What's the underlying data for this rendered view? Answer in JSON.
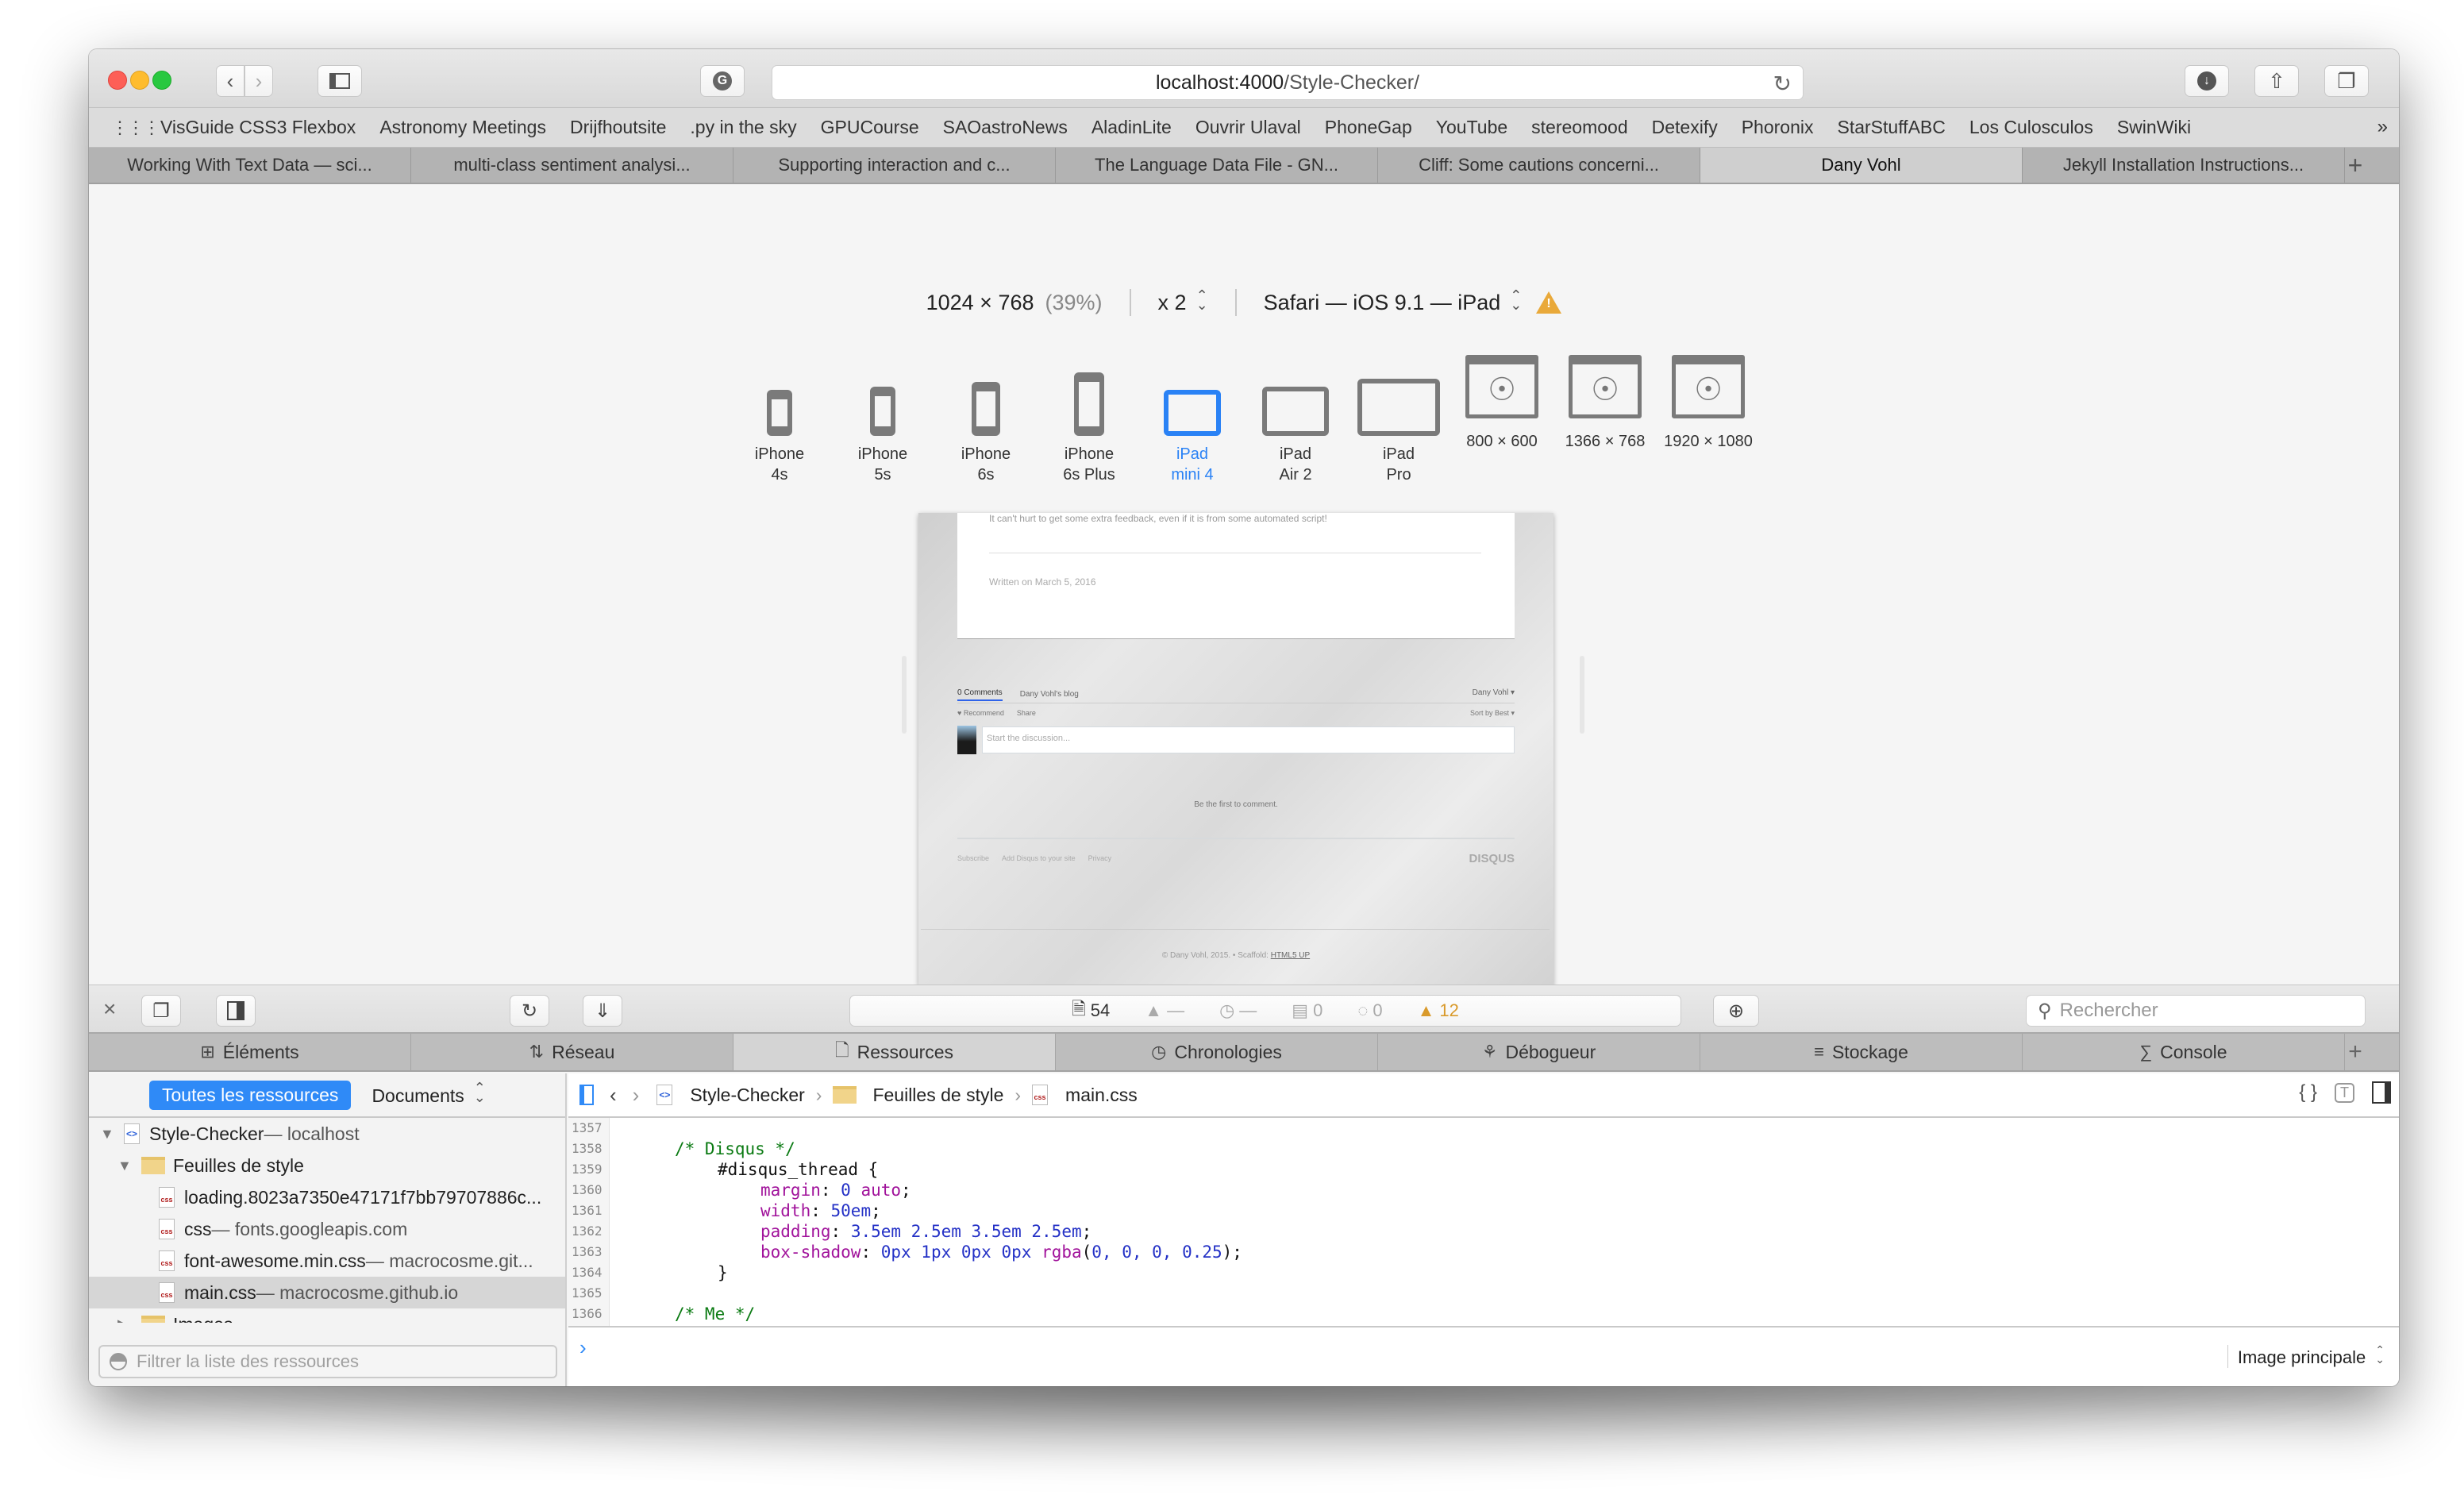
{
  "window": {
    "url_host": "localhost:4000",
    "url_path": "/Style-Checker/"
  },
  "bookmarks": [
    "VisGuide CSS3 Flexbox",
    "Astronomy Meetings",
    "Drijfhoutsite",
    ".py in the sky",
    "GPUCourse",
    "SAOastroNews",
    "AladinLite",
    "Ouvrir Ulaval",
    "PhoneGap",
    "YouTube",
    "stereomood",
    "Detexify",
    "Phoronix",
    "StarStuffABC",
    "Los Culosculos",
    "SwinWiki"
  ],
  "bookmarks_more": "»",
  "tabs": [
    {
      "label": "Working With Text Data — sci...",
      "active": false
    },
    {
      "label": "multi-class sentiment analysi...",
      "active": false
    },
    {
      "label": "Supporting interaction and c...",
      "active": false
    },
    {
      "label": "The Language Data File - GN...",
      "active": false
    },
    {
      "label": "Cliff: Some cautions concerni...",
      "active": false
    },
    {
      "label": "Dany Vohl",
      "active": true
    },
    {
      "label": "Jekyll Installation Instructions...",
      "active": false
    }
  ],
  "responsive": {
    "dimensions": "1024 × 768",
    "scale_pct": "(39%)",
    "pixel_ratio": "x 2",
    "user_agent": "Safari — iOS 9.1 — iPad",
    "devices": [
      {
        "line1": "iPhone",
        "line2": "4s",
        "kind": "phone",
        "active": false
      },
      {
        "line1": "iPhone",
        "line2": "5s",
        "kind": "phone",
        "active": false
      },
      {
        "line1": "iPhone",
        "line2": "6s",
        "kind": "phone",
        "active": false
      },
      {
        "line1": "iPhone",
        "line2": "6s Plus",
        "kind": "phone",
        "active": false
      },
      {
        "line1": "iPad",
        "line2": "mini 4",
        "kind": "tablet",
        "active": true
      },
      {
        "line1": "iPad",
        "line2": "Air 2",
        "kind": "tablet",
        "active": false
      },
      {
        "line1": "iPad",
        "line2": "Pro",
        "kind": "tablet",
        "active": false
      },
      {
        "line1": "800 × 600",
        "line2": "",
        "kind": "desktop",
        "active": false
      },
      {
        "line1": "1366 × 768",
        "line2": "",
        "kind": "desktop",
        "active": false
      },
      {
        "line1": "1920 × 1080",
        "line2": "",
        "kind": "desktop",
        "active": false
      }
    ]
  },
  "preview": {
    "post_text": "It can't hurt to get some extra feedback, even if it is from some automated script!",
    "written_on": "Written on March 5, 2016",
    "comments_tab": "0 Comments",
    "blog_tab": "Dany Vohl's blog",
    "user": "Dany Vohl ▾",
    "recommend": "♥ Recommend",
    "share": "Share",
    "sort": "Sort by Best ▾",
    "discussion_placeholder": "Start the discussion...",
    "first_comment": "Be the first to comment.",
    "subscribe": "Subscribe",
    "add_disqus": "Add Disqus to your site",
    "privacy": "Privacy",
    "disqus_logo": "DISQUS",
    "copyright": "© Dany Vohl, 2015.  •  Scaffold: ",
    "scaffold_link": "HTML5 UP"
  },
  "inspector": {
    "resource_count": "54",
    "size_value": "—",
    "time_value": "—",
    "logs": "0",
    "errors": "0",
    "warnings": "12",
    "search_placeholder": "Rechercher",
    "tabs": [
      {
        "label": "Éléments",
        "icon": "⊞",
        "name": "elements",
        "active": false
      },
      {
        "label": "Réseau",
        "icon": "⇅",
        "name": "network",
        "active": false
      },
      {
        "label": "Ressources",
        "icon": "🗋",
        "name": "resources",
        "active": true
      },
      {
        "label": "Chronologies",
        "icon": "◷",
        "name": "timelines",
        "active": false
      },
      {
        "label": "Débogueur",
        "icon": "⚘",
        "name": "debugger",
        "active": false
      },
      {
        "label": "Stockage",
        "icon": "≡",
        "name": "storage",
        "active": false
      },
      {
        "label": "Console",
        "icon": "∑",
        "name": "console",
        "active": false
      }
    ]
  },
  "sidebar": {
    "all_resources": "Toutes les ressources",
    "documents": "Documents",
    "tree": [
      {
        "name": "Style-Checker",
        "suffix": " — localhost",
        "level": 0,
        "type": "html",
        "twisty": "▼"
      },
      {
        "name": "Feuilles de style",
        "suffix": "",
        "level": 1,
        "type": "folder",
        "twisty": "▼"
      },
      {
        "name": "loading.8023a7350e47171f7bb79707886c...",
        "suffix": "",
        "level": 2,
        "type": "css",
        "twisty": ""
      },
      {
        "name": "css",
        "suffix": " — fonts.googleapis.com",
        "level": 2,
        "type": "css",
        "twisty": ""
      },
      {
        "name": "font-awesome.min.css",
        "suffix": " — macrocosme.git...",
        "level": 2,
        "type": "css",
        "twisty": ""
      },
      {
        "name": "main.css",
        "suffix": " — macrocosme.github.io",
        "level": 2,
        "type": "css",
        "twisty": "",
        "selected": true
      },
      {
        "name": "Images",
        "suffix": "",
        "level": 1,
        "type": "folder",
        "twisty": "▶"
      }
    ],
    "filter_placeholder": "Filtrer la liste des ressources"
  },
  "editor": {
    "breadcrumb": [
      "Style-Checker",
      "Feuilles de style",
      "main.css"
    ],
    "lines": [
      {
        "n": "1357",
        "indent": 0,
        "parts": []
      },
      {
        "n": "1358",
        "indent": 1,
        "parts": [
          {
            "c": "com",
            "t": "/* Disqus */"
          }
        ]
      },
      {
        "n": "1359",
        "indent": 2,
        "parts": [
          {
            "c": "",
            "t": "#disqus_thread {"
          }
        ]
      },
      {
        "n": "1360",
        "indent": 3,
        "parts": [
          {
            "c": "prop",
            "t": "margin"
          },
          {
            "c": "",
            "t": ": "
          },
          {
            "c": "val",
            "t": "0"
          },
          {
            "c": "",
            "t": " "
          },
          {
            "c": "prop",
            "t": "auto"
          },
          {
            "c": "",
            "t": ";"
          }
        ]
      },
      {
        "n": "1361",
        "indent": 3,
        "parts": [
          {
            "c": "prop",
            "t": "width"
          },
          {
            "c": "",
            "t": ": "
          },
          {
            "c": "val",
            "t": "50em"
          },
          {
            "c": "",
            "t": ";"
          }
        ]
      },
      {
        "n": "1362",
        "indent": 3,
        "parts": [
          {
            "c": "prop",
            "t": "padding"
          },
          {
            "c": "",
            "t": ": "
          },
          {
            "c": "val",
            "t": "3.5em 2.5em 3.5em 2.5em"
          },
          {
            "c": "",
            "t": ";"
          }
        ]
      },
      {
        "n": "1363",
        "indent": 3,
        "parts": [
          {
            "c": "prop",
            "t": "box-shadow"
          },
          {
            "c": "",
            "t": ": "
          },
          {
            "c": "val",
            "t": "0px 1px 0px 0px"
          },
          {
            "c": "",
            "t": " "
          },
          {
            "c": "prop",
            "t": "rgba"
          },
          {
            "c": "",
            "t": "("
          },
          {
            "c": "val",
            "t": "0, 0, 0, 0.25"
          },
          {
            "c": "",
            "t": ");"
          }
        ]
      },
      {
        "n": "1364",
        "indent": 2,
        "parts": [
          {
            "c": "",
            "t": "}"
          }
        ]
      },
      {
        "n": "1365",
        "indent": 0,
        "parts": []
      },
      {
        "n": "1366",
        "indent": 1,
        "parts": [
          {
            "c": "com",
            "t": "/* Me */"
          }
        ]
      }
    ],
    "console_prompt": "›",
    "context": "Image principale"
  },
  "colors": {
    "accent": "#2f8af7",
    "warning": "#d99a2b"
  }
}
